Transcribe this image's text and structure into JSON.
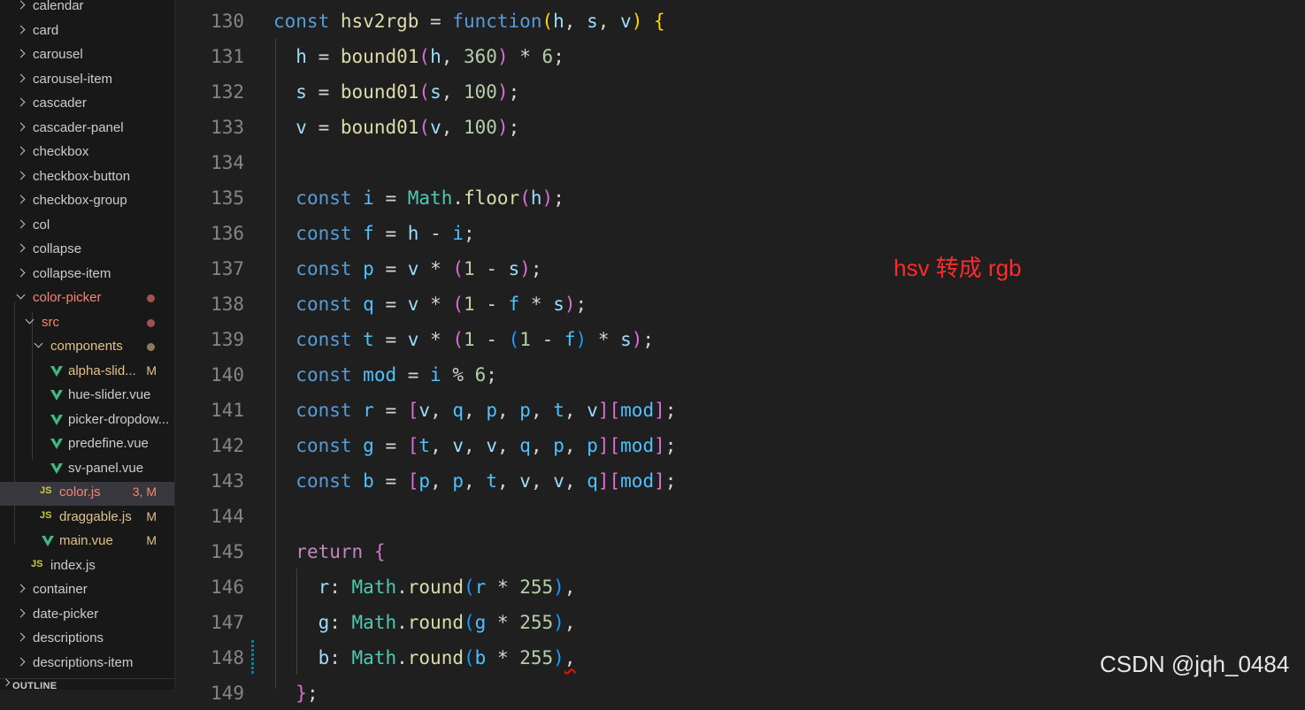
{
  "explorer": {
    "items": [
      {
        "label": "calendar",
        "expanded": false,
        "icon": "chevron-right-icon"
      },
      {
        "label": "card",
        "expanded": false,
        "icon": "chevron-right-icon"
      },
      {
        "label": "carousel",
        "expanded": false,
        "icon": "chevron-right-icon"
      },
      {
        "label": "carousel-item",
        "expanded": false,
        "icon": "chevron-right-icon"
      },
      {
        "label": "cascader",
        "expanded": false,
        "icon": "chevron-right-icon"
      },
      {
        "label": "cascader-panel",
        "expanded": false,
        "icon": "chevron-right-icon"
      },
      {
        "label": "checkbox",
        "expanded": false,
        "icon": "chevron-right-icon"
      },
      {
        "label": "checkbox-button",
        "expanded": false,
        "icon": "chevron-right-icon"
      },
      {
        "label": "checkbox-group",
        "expanded": false,
        "icon": "chevron-right-icon"
      },
      {
        "label": "col",
        "expanded": false,
        "icon": "chevron-right-icon"
      },
      {
        "label": "collapse",
        "expanded": false,
        "icon": "chevron-right-icon"
      },
      {
        "label": "collapse-item",
        "expanded": false,
        "icon": "chevron-right-icon"
      },
      {
        "label": "color-picker",
        "expanded": true,
        "icon": "chevron-down-icon",
        "status": "modified-dot"
      },
      {
        "label": "src",
        "expanded": true,
        "icon": "chevron-down-icon",
        "status": "modified-dot"
      },
      {
        "label": "components",
        "expanded": true,
        "icon": "chevron-down-icon",
        "status": "modified-dot"
      },
      {
        "label": "alpha-slid...",
        "icon": "vue-file-icon",
        "badge": "M"
      },
      {
        "label": "hue-slider.vue",
        "icon": "vue-file-icon"
      },
      {
        "label": "picker-dropdow...",
        "icon": "vue-file-icon"
      },
      {
        "label": "predefine.vue",
        "icon": "vue-file-icon"
      },
      {
        "label": "sv-panel.vue",
        "icon": "vue-file-icon"
      },
      {
        "label": "color.js",
        "icon": "js-file-icon",
        "badge": "3, M",
        "selected": true
      },
      {
        "label": "draggable.js",
        "icon": "js-file-icon",
        "badge": "M"
      },
      {
        "label": "main.vue",
        "icon": "vue-file-icon",
        "badge": "M"
      },
      {
        "label": "index.js",
        "icon": "js-file-icon"
      },
      {
        "label": "container",
        "expanded": false,
        "icon": "chevron-right-icon"
      },
      {
        "label": "date-picker",
        "expanded": false,
        "icon": "chevron-right-icon"
      },
      {
        "label": "descriptions",
        "expanded": false,
        "icon": "chevron-right-icon"
      },
      {
        "label": "descriptions-item",
        "expanded": false,
        "icon": "chevron-right-icon"
      }
    ],
    "js_icon_text": "JS",
    "outline_label": "OUTLINE"
  },
  "editor": {
    "lines": [
      {
        "num": "130",
        "tokens": [
          [
            "k-const",
            "const"
          ],
          [
            "op",
            " "
          ],
          [
            "fn",
            "hsv2rgb"
          ],
          [
            "op",
            " = "
          ],
          [
            "k-const",
            "function"
          ],
          [
            "br1",
            "("
          ],
          [
            "vr",
            "h"
          ],
          [
            "op",
            ", "
          ],
          [
            "vr",
            "s"
          ],
          [
            "op",
            ", "
          ],
          [
            "vr",
            "v"
          ],
          [
            "br1",
            ")"
          ],
          [
            "op",
            " "
          ],
          [
            "br1",
            "{"
          ]
        ]
      },
      {
        "num": "131",
        "tokens": [
          [
            "op",
            "  "
          ],
          [
            "vr",
            "h"
          ],
          [
            "op",
            " = "
          ],
          [
            "fn",
            "bound01"
          ],
          [
            "br2",
            "("
          ],
          [
            "vr",
            "h"
          ],
          [
            "op",
            ", "
          ],
          [
            "num",
            "360"
          ],
          [
            "br2",
            ")"
          ],
          [
            "op",
            " * "
          ],
          [
            "num",
            "6"
          ],
          [
            "op",
            ";"
          ]
        ]
      },
      {
        "num": "132",
        "tokens": [
          [
            "op",
            "  "
          ],
          [
            "vr",
            "s"
          ],
          [
            "op",
            " = "
          ],
          [
            "fn",
            "bound01"
          ],
          [
            "br2",
            "("
          ],
          [
            "vr",
            "s"
          ],
          [
            "op",
            ", "
          ],
          [
            "num",
            "100"
          ],
          [
            "br2",
            ")"
          ],
          [
            "op",
            ";"
          ]
        ]
      },
      {
        "num": "133",
        "tokens": [
          [
            "op",
            "  "
          ],
          [
            "vr",
            "v"
          ],
          [
            "op",
            " = "
          ],
          [
            "fn",
            "bound01"
          ],
          [
            "br2",
            "("
          ],
          [
            "vr",
            "v"
          ],
          [
            "op",
            ", "
          ],
          [
            "num",
            "100"
          ],
          [
            "br2",
            ")"
          ],
          [
            "op",
            ";"
          ]
        ]
      },
      {
        "num": "134",
        "tokens": []
      },
      {
        "num": "135",
        "tokens": [
          [
            "op",
            "  "
          ],
          [
            "k-const",
            "const"
          ],
          [
            "op",
            " "
          ],
          [
            "cn",
            "i"
          ],
          [
            "op",
            " = "
          ],
          [
            "cls",
            "Math"
          ],
          [
            "op",
            "."
          ],
          [
            "fn",
            "floor"
          ],
          [
            "br2",
            "("
          ],
          [
            "vr",
            "h"
          ],
          [
            "br2",
            ")"
          ],
          [
            "op",
            ";"
          ]
        ]
      },
      {
        "num": "136",
        "tokens": [
          [
            "op",
            "  "
          ],
          [
            "k-const",
            "const"
          ],
          [
            "op",
            " "
          ],
          [
            "cn",
            "f"
          ],
          [
            "op",
            " = "
          ],
          [
            "vr",
            "h"
          ],
          [
            "op",
            " - "
          ],
          [
            "cn",
            "i"
          ],
          [
            "op",
            ";"
          ]
        ]
      },
      {
        "num": "137",
        "tokens": [
          [
            "op",
            "  "
          ],
          [
            "k-const",
            "const"
          ],
          [
            "op",
            " "
          ],
          [
            "cn",
            "p"
          ],
          [
            "op",
            " = "
          ],
          [
            "vr",
            "v"
          ],
          [
            "op",
            " * "
          ],
          [
            "br2",
            "("
          ],
          [
            "num",
            "1"
          ],
          [
            "op",
            " - "
          ],
          [
            "vr",
            "s"
          ],
          [
            "br2",
            ")"
          ],
          [
            "op",
            ";"
          ]
        ]
      },
      {
        "num": "138",
        "tokens": [
          [
            "op",
            "  "
          ],
          [
            "k-const",
            "const"
          ],
          [
            "op",
            " "
          ],
          [
            "cn",
            "q"
          ],
          [
            "op",
            " = "
          ],
          [
            "vr",
            "v"
          ],
          [
            "op",
            " * "
          ],
          [
            "br2",
            "("
          ],
          [
            "num",
            "1"
          ],
          [
            "op",
            " - "
          ],
          [
            "cn",
            "f"
          ],
          [
            "op",
            " * "
          ],
          [
            "vr",
            "s"
          ],
          [
            "br2",
            ")"
          ],
          [
            "op",
            ";"
          ]
        ]
      },
      {
        "num": "139",
        "tokens": [
          [
            "op",
            "  "
          ],
          [
            "k-const",
            "const"
          ],
          [
            "op",
            " "
          ],
          [
            "cn",
            "t"
          ],
          [
            "op",
            " = "
          ],
          [
            "vr",
            "v"
          ],
          [
            "op",
            " * "
          ],
          [
            "br2",
            "("
          ],
          [
            "num",
            "1"
          ],
          [
            "op",
            " - "
          ],
          [
            "br3",
            "("
          ],
          [
            "num",
            "1"
          ],
          [
            "op",
            " - "
          ],
          [
            "cn",
            "f"
          ],
          [
            "br3",
            ")"
          ],
          [
            "op",
            " * "
          ],
          [
            "vr",
            "s"
          ],
          [
            "br2",
            ")"
          ],
          [
            "op",
            ";"
          ]
        ]
      },
      {
        "num": "140",
        "tokens": [
          [
            "op",
            "  "
          ],
          [
            "k-const",
            "const"
          ],
          [
            "op",
            " "
          ],
          [
            "cn",
            "mod"
          ],
          [
            "op",
            " = "
          ],
          [
            "cn",
            "i"
          ],
          [
            "op",
            " % "
          ],
          [
            "num",
            "6"
          ],
          [
            "op",
            ";"
          ]
        ]
      },
      {
        "num": "141",
        "tokens": [
          [
            "op",
            "  "
          ],
          [
            "k-const",
            "const"
          ],
          [
            "op",
            " "
          ],
          [
            "cn",
            "r"
          ],
          [
            "op",
            " = "
          ],
          [
            "br2",
            "["
          ],
          [
            "vr",
            "v"
          ],
          [
            "op",
            ", "
          ],
          [
            "cn",
            "q"
          ],
          [
            "op",
            ", "
          ],
          [
            "cn",
            "p"
          ],
          [
            "op",
            ", "
          ],
          [
            "cn",
            "p"
          ],
          [
            "op",
            ", "
          ],
          [
            "cn",
            "t"
          ],
          [
            "op",
            ", "
          ],
          [
            "vr",
            "v"
          ],
          [
            "br2",
            "]"
          ],
          [
            "br2",
            "["
          ],
          [
            "cn",
            "mod"
          ],
          [
            "br2",
            "]"
          ],
          [
            "op",
            ";"
          ]
        ]
      },
      {
        "num": "142",
        "tokens": [
          [
            "op",
            "  "
          ],
          [
            "k-const",
            "const"
          ],
          [
            "op",
            " "
          ],
          [
            "cn",
            "g"
          ],
          [
            "op",
            " = "
          ],
          [
            "br2",
            "["
          ],
          [
            "cn",
            "t"
          ],
          [
            "op",
            ", "
          ],
          [
            "vr",
            "v"
          ],
          [
            "op",
            ", "
          ],
          [
            "vr",
            "v"
          ],
          [
            "op",
            ", "
          ],
          [
            "cn",
            "q"
          ],
          [
            "op",
            ", "
          ],
          [
            "cn",
            "p"
          ],
          [
            "op",
            ", "
          ],
          [
            "cn",
            "p"
          ],
          [
            "br2",
            "]"
          ],
          [
            "br2",
            "["
          ],
          [
            "cn",
            "mod"
          ],
          [
            "br2",
            "]"
          ],
          [
            "op",
            ";"
          ]
        ]
      },
      {
        "num": "143",
        "tokens": [
          [
            "op",
            "  "
          ],
          [
            "k-const",
            "const"
          ],
          [
            "op",
            " "
          ],
          [
            "cn",
            "b"
          ],
          [
            "op",
            " = "
          ],
          [
            "br2",
            "["
          ],
          [
            "cn",
            "p"
          ],
          [
            "op",
            ", "
          ],
          [
            "cn",
            "p"
          ],
          [
            "op",
            ", "
          ],
          [
            "cn",
            "t"
          ],
          [
            "op",
            ", "
          ],
          [
            "vr",
            "v"
          ],
          [
            "op",
            ", "
          ],
          [
            "vr",
            "v"
          ],
          [
            "op",
            ", "
          ],
          [
            "cn",
            "q"
          ],
          [
            "br2",
            "]"
          ],
          [
            "br2",
            "["
          ],
          [
            "cn",
            "mod"
          ],
          [
            "br2",
            "]"
          ],
          [
            "op",
            ";"
          ]
        ]
      },
      {
        "num": "144",
        "tokens": []
      },
      {
        "num": "145",
        "tokens": [
          [
            "op",
            "  "
          ],
          [
            "k-ctrl",
            "return"
          ],
          [
            "op",
            " "
          ],
          [
            "br2",
            "{"
          ]
        ]
      },
      {
        "num": "146",
        "tokens": [
          [
            "op",
            "    "
          ],
          [
            "vr",
            "r"
          ],
          [
            "op",
            ": "
          ],
          [
            "cls",
            "Math"
          ],
          [
            "op",
            "."
          ],
          [
            "fn",
            "round"
          ],
          [
            "br3",
            "("
          ],
          [
            "cn",
            "r"
          ],
          [
            "op",
            " * "
          ],
          [
            "num",
            "255"
          ],
          [
            "br3",
            ")"
          ],
          [
            "op",
            ","
          ]
        ]
      },
      {
        "num": "147",
        "tokens": [
          [
            "op",
            "    "
          ],
          [
            "vr",
            "g"
          ],
          [
            "op",
            ": "
          ],
          [
            "cls",
            "Math"
          ],
          [
            "op",
            "."
          ],
          [
            "fn",
            "round"
          ],
          [
            "br3",
            "("
          ],
          [
            "cn",
            "g"
          ],
          [
            "op",
            " * "
          ],
          [
            "num",
            "255"
          ],
          [
            "br3",
            ")"
          ],
          [
            "op",
            ","
          ]
        ]
      },
      {
        "num": "148",
        "tokens": [
          [
            "op",
            "    "
          ],
          [
            "vr",
            "b"
          ],
          [
            "op",
            ": "
          ],
          [
            "cls",
            "Math"
          ],
          [
            "op",
            "."
          ],
          [
            "fn",
            "round"
          ],
          [
            "br3",
            "("
          ],
          [
            "cn",
            "b"
          ],
          [
            "op",
            " * "
          ],
          [
            "num",
            "255"
          ],
          [
            "br3",
            ")"
          ],
          [
            "op",
            ","
          ]
        ]
      },
      {
        "num": "149",
        "tokens": [
          [
            "op",
            "  "
          ],
          [
            "br2",
            "}"
          ],
          [
            "op",
            ";"
          ]
        ]
      }
    ]
  },
  "annotation": "hsv 转成 rgb",
  "watermark": "CSDN @jqh_0484",
  "colors": {
    "modified": "#e2c08d",
    "error_file": "#f48771",
    "annotation": "#ff2b2b"
  }
}
